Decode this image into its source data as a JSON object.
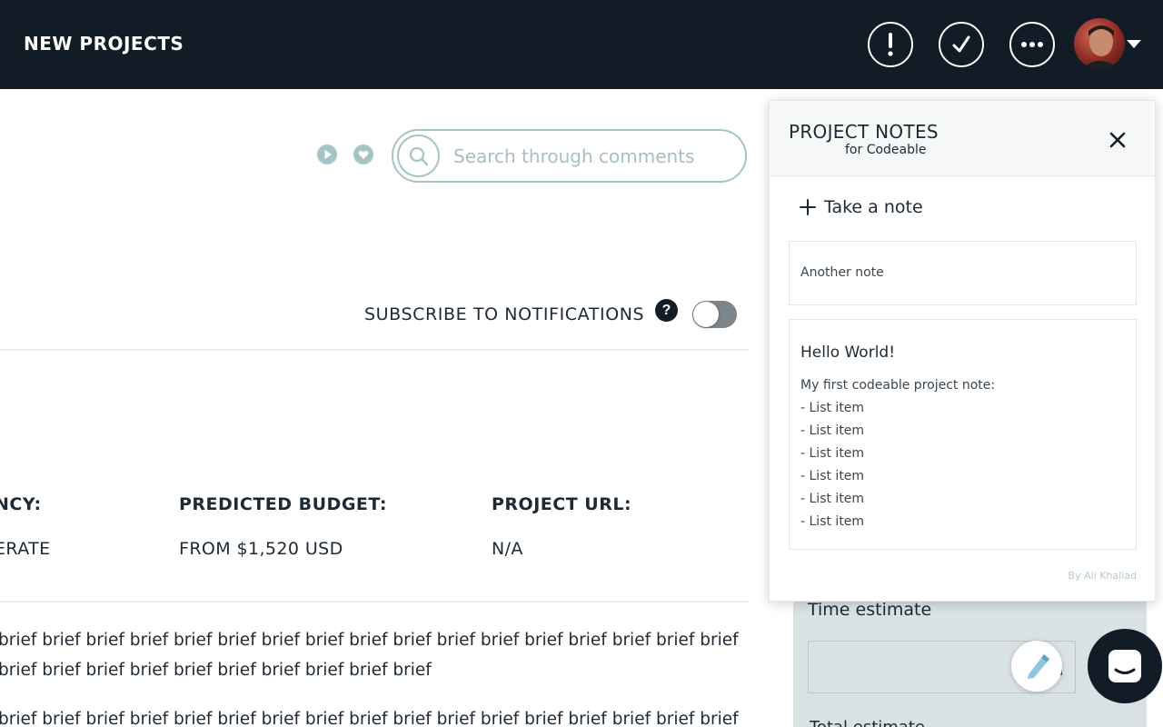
{
  "header": {
    "title": "NEW PROJECTS",
    "buttons": [
      {
        "name": "alert",
        "icon": "exclamation-icon"
      },
      {
        "name": "done",
        "icon": "check-icon"
      },
      {
        "name": "more",
        "icon": "ellipsis-icon"
      }
    ],
    "avatar_icon": "user-avatar"
  },
  "comments": {
    "search_placeholder": "Search through comments",
    "icons": [
      "play-icon",
      "heart-icon"
    ]
  },
  "notifications": {
    "label": "SUBSCRIBE TO NOTIFICATIONS",
    "help": "?",
    "enabled": false
  },
  "details": [
    {
      "label": "NCY:",
      "value": "ERATE"
    },
    {
      "label": "PREDICTED BUDGET:",
      "value": "FROM $1,520 USD"
    },
    {
      "label": "PROJECT URL:",
      "value": "N/A"
    }
  ],
  "brief": [
    "brief brief brief brief brief brief brief brief brief brief brief brief brief brief brief brief brief",
    "brief brief brief brief brief brief brief brief brief brief",
    "brief brief brief brief brief brief brief brief brief brief brief brief brief brief brief brief brief"
  ],
  "estimate": {
    "title": "Time estimate",
    "input_suffix": "h",
    "sub_label": "Total estimate"
  },
  "notes_panel": {
    "title": "PROJECT NOTES",
    "subtitle": "for Codeable",
    "take_note": "Take a note",
    "notes": [
      {
        "text": "Another note"
      },
      {
        "heading": "Hello World!",
        "lines": [
          "My first codeable project note:",
          "- List item",
          "- List item",
          "- List item",
          "- List item",
          "- List item",
          "- List item"
        ]
      }
    ],
    "credit": "By Ali Khallad"
  },
  "colors": {
    "topbar": "#121c27",
    "accent": "#a7c4c4",
    "text": "#1d2a35"
  }
}
